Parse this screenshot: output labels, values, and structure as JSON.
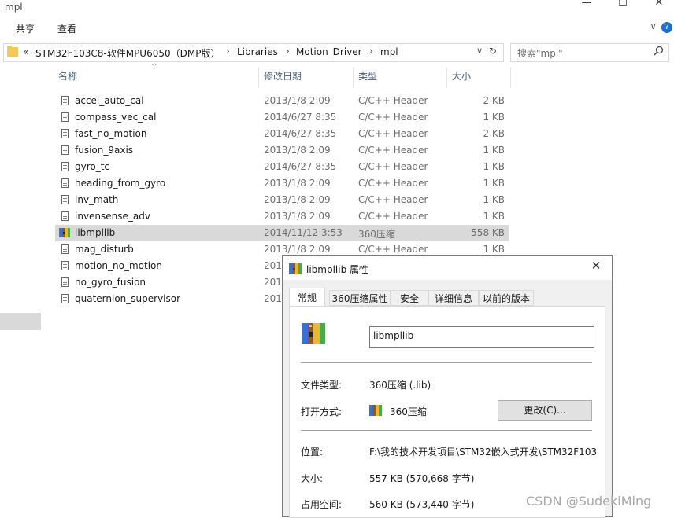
{
  "window": {
    "title": "mpl",
    "minimize_glyph": "—",
    "maximize_glyph": "☐",
    "close_glyph": "✕"
  },
  "ribbon": {
    "tabs": [
      "共享",
      "查看"
    ],
    "expand_glyph": "∨",
    "help_glyph": "?"
  },
  "address": {
    "crumbs": [
      "«",
      "STM32F103C8-软件MPU6050（DMP版）",
      "Libraries",
      "Motion_Driver",
      "mpl"
    ],
    "separator": "›",
    "dropdown_glyph": "∨",
    "refresh_glyph": "↻"
  },
  "search": {
    "placeholder": "搜索\"mpl\"",
    "icon": "search-icon"
  },
  "columns": {
    "name": "名称",
    "date": "修改日期",
    "type": "类型",
    "size": "大小",
    "sort_glyph": "^"
  },
  "files": [
    {
      "name": "accel_auto_cal",
      "date": "2013/1/8 2:09",
      "type": "C/C++ Header",
      "size": "2 KB"
    },
    {
      "name": "compass_vec_cal",
      "date": "2014/6/27 8:35",
      "type": "C/C++ Header",
      "size": "1 KB"
    },
    {
      "name": "fast_no_motion",
      "date": "2014/6/27 8:35",
      "type": "C/C++ Header",
      "size": "2 KB"
    },
    {
      "name": "fusion_9axis",
      "date": "2013/1/8 2:09",
      "type": "C/C++ Header",
      "size": "1 KB"
    },
    {
      "name": "gyro_tc",
      "date": "2014/6/27 8:35",
      "type": "C/C++ Header",
      "size": "1 KB"
    },
    {
      "name": "heading_from_gyro",
      "date": "2013/1/8 2:09",
      "type": "C/C++ Header",
      "size": "1 KB"
    },
    {
      "name": "inv_math",
      "date": "2013/1/8 2:09",
      "type": "C/C++ Header",
      "size": "1 KB"
    },
    {
      "name": "invensense_adv",
      "date": "2013/1/8 2:09",
      "type": "C/C++ Header",
      "size": "1 KB"
    },
    {
      "name": "libmpllib",
      "date": "2014/11/12 3:53",
      "type": "360压缩",
      "size": "558 KB"
    },
    {
      "name": "mag_disturb",
      "date": "2013/1/8 2:09",
      "type": "C/C++ Header",
      "size": "1 KB"
    },
    {
      "name": "motion_no_motion",
      "date": "2013",
      "type": "",
      "size": ""
    },
    {
      "name": "no_gyro_fusion",
      "date": "2013",
      "type": "",
      "size": ""
    },
    {
      "name": "quaternion_supervisor",
      "date": "2013",
      "type": "",
      "size": ""
    }
  ],
  "dialog": {
    "title": "libmpllib 属性",
    "close_glyph": "✕",
    "tabs": [
      "常规",
      "360压缩属性",
      "安全",
      "详细信息",
      "以前的版本"
    ],
    "file_name": "libmpllib",
    "type_label": "文件类型:",
    "type_value": "360压缩 (.lib)",
    "open_label": "打开方式:",
    "open_value": "360压缩",
    "change_button": "更改(C)...",
    "location_label": "位置:",
    "location_value": "F:\\我的技术开发项目\\STM32嵌入式开发\\STM32F103",
    "size_label": "大小:",
    "size_value": "557 KB (570,668 字节)",
    "disk_label": "占用空间:",
    "disk_value": "560 KB (573,440 字节)"
  },
  "watermark": "CSDN @SudekiMing"
}
